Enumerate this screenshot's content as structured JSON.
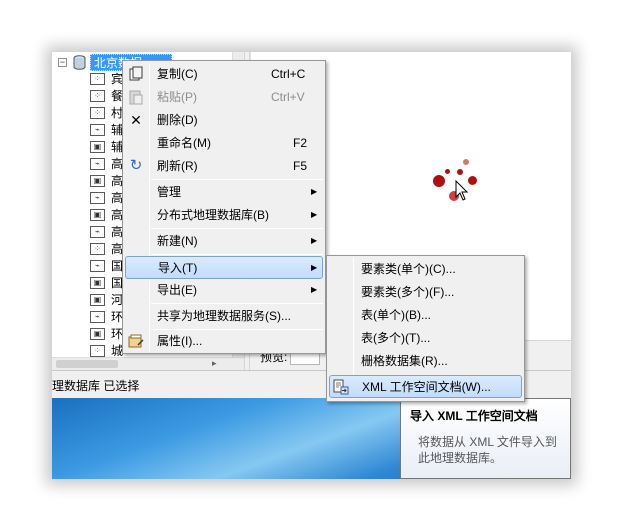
{
  "tree": {
    "root_label": "北京数据...",
    "items": [
      {
        "icon": "point-feature-class-icon",
        "glyph": "⁘",
        "label": "宾"
      },
      {
        "icon": "point-feature-class-icon",
        "glyph": "⁘",
        "label": "餐"
      },
      {
        "icon": "point-feature-class-icon",
        "glyph": "⁘",
        "label": "村"
      },
      {
        "icon": "line-feature-class-icon",
        "glyph": "⌁",
        "label": "辅"
      },
      {
        "icon": "polygon-feature-class-icon",
        "glyph": "▣",
        "label": "辅"
      },
      {
        "icon": "line-feature-class-icon",
        "glyph": "⌁",
        "label": "高"
      },
      {
        "icon": "polygon-feature-class-icon",
        "glyph": "▣",
        "label": "高"
      },
      {
        "icon": "line-feature-class-icon",
        "glyph": "⌁",
        "label": "高"
      },
      {
        "icon": "polygon-feature-class-icon",
        "glyph": "▣",
        "label": "高"
      },
      {
        "icon": "line-feature-class-icon",
        "glyph": "⌁",
        "label": "高"
      },
      {
        "icon": "point-feature-class-icon",
        "glyph": "⁘",
        "label": "高"
      },
      {
        "icon": "line-feature-class-icon",
        "glyph": "⌁",
        "label": "国"
      },
      {
        "icon": "polygon-feature-class-icon",
        "glyph": "▣",
        "label": "国"
      },
      {
        "icon": "polygon-feature-class-icon",
        "glyph": "▣",
        "label": "河"
      },
      {
        "icon": "line-feature-class-icon",
        "glyph": "⌁",
        "label": "环"
      },
      {
        "icon": "polygon-feature-class-icon",
        "glyph": "▣",
        "label": "环"
      },
      {
        "icon": "point-feature-class-icon",
        "glyph": "⁘",
        "label": "城"
      }
    ]
  },
  "preview": {
    "label": "预览:"
  },
  "status": {
    "text": "理数据库 已选择"
  },
  "context_menu": {
    "copy": {
      "label": "复制(C)",
      "shortcut": "Ctrl+C"
    },
    "paste": {
      "label": "粘贴(P)",
      "shortcut": "Ctrl+V"
    },
    "delete": {
      "label": "删除(D)"
    },
    "rename": {
      "label": "重命名(M)",
      "shortcut": "F2"
    },
    "refresh": {
      "label": "刷新(R)",
      "shortcut": "F5"
    },
    "manage": {
      "label": "管理"
    },
    "distributed": {
      "label": "分布式地理数据库(B)"
    },
    "new": {
      "label": "新建(N)"
    },
    "import": {
      "label": "导入(T)"
    },
    "export": {
      "label": "导出(E)"
    },
    "share": {
      "label": "共享为地理数据服务(S)..."
    },
    "properties": {
      "label": "属性(I)..."
    }
  },
  "import_submenu": {
    "fc_single": "要素类(单个)(C)...",
    "fc_multiple": "要素类(多个)(F)...",
    "table_single": "表(单个)(B)...",
    "table_multiple": "表(多个)(T)...",
    "raster_dataset": "栅格数据集(R)...",
    "xml_workspace": "XML 工作空间文档(W)..."
  },
  "tooltip": {
    "title": "导入 XML 工作空间文档",
    "body": "将数据从 XML 文件导入到此地理数据库。"
  },
  "colors": {
    "selection": "#3399ff",
    "menu_hover_border": "#7da2ce",
    "dot_dark_red": "#b00f0f",
    "dot_light_red": "#d07a6a"
  }
}
